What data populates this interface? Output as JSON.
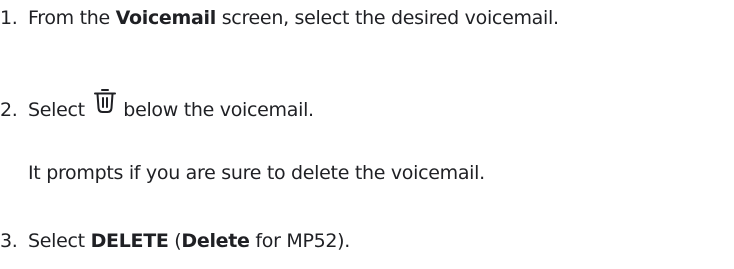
{
  "steps": [
    {
      "number": "1.",
      "parts": {
        "a": "From the ",
        "b": "Voicemail",
        "c": " screen, select the desired voicemail."
      }
    },
    {
      "number": "2.",
      "parts": {
        "a": "Select ",
        "icon": "trash-icon",
        "c": " below the voicemail."
      },
      "note": "It prompts if you are sure to delete the voicemail."
    },
    {
      "number": "3.",
      "parts": {
        "a": "Select ",
        "b": "DELETE",
        "c": " (",
        "d": "Delete",
        "e": " for MP52)."
      }
    }
  ]
}
